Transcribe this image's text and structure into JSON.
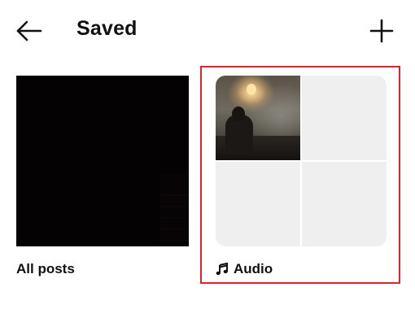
{
  "header": {
    "title": "Saved",
    "back_icon": "arrow-left-icon",
    "add_icon": "plus-icon"
  },
  "collections": [
    {
      "label": "All posts",
      "thumbnail": "dark-image"
    },
    {
      "label": "Audio",
      "icon": "music-note-icon",
      "thumbnail": "2x2-grid-one-photo"
    }
  ],
  "colors": {
    "highlight_border": "#d9232d",
    "placeholder_cell": "#efefef",
    "text": "#111111"
  }
}
